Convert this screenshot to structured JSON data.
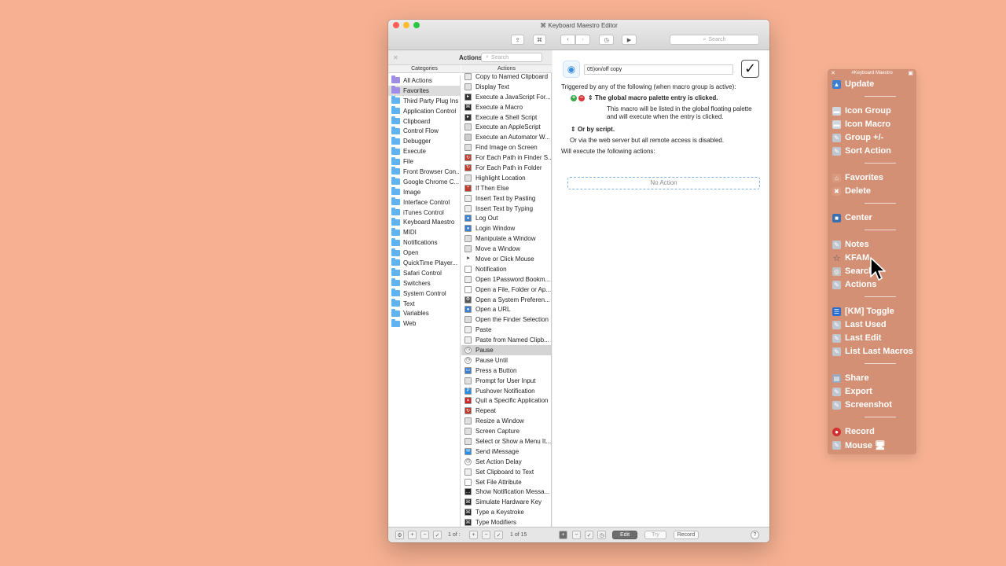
{
  "window": {
    "title": "Keyboard Maestro Editor",
    "search_placeholder": "Search"
  },
  "actions_panel": {
    "title": "Actions",
    "search_placeholder": "Search",
    "categories_header": "Categories",
    "actions_header": "Actions",
    "categories": [
      {
        "label": "All Actions",
        "icon": "purple-folder",
        "selected": false
      },
      {
        "label": "Favorites",
        "icon": "purple-folder",
        "selected": true
      },
      {
        "label": "Third Party Plug Ins",
        "icon": "blue-folder"
      },
      {
        "label": "Application Control",
        "icon": "blue-folder"
      },
      {
        "label": "Clipboard",
        "icon": "blue-folder"
      },
      {
        "label": "Control Flow",
        "icon": "blue-folder"
      },
      {
        "label": "Debugger",
        "icon": "blue-folder"
      },
      {
        "label": "Execute",
        "icon": "blue-folder"
      },
      {
        "label": "File",
        "icon": "blue-folder"
      },
      {
        "label": "Front Browser Con...",
        "icon": "blue-folder"
      },
      {
        "label": "Google Chrome C...",
        "icon": "blue-folder"
      },
      {
        "label": "Image",
        "icon": "blue-folder"
      },
      {
        "label": "Interface Control",
        "icon": "blue-folder"
      },
      {
        "label": "iTunes Control",
        "icon": "blue-folder"
      },
      {
        "label": "Keyboard Maestro",
        "icon": "blue-folder"
      },
      {
        "label": "MIDI",
        "icon": "blue-folder"
      },
      {
        "label": "Notifications",
        "icon": "blue-folder"
      },
      {
        "label": "Open",
        "icon": "blue-folder"
      },
      {
        "label": "QuickTime Player...",
        "icon": "blue-folder"
      },
      {
        "label": "Safari Control",
        "icon": "blue-folder"
      },
      {
        "label": "Switchers",
        "icon": "blue-folder"
      },
      {
        "label": "System Control",
        "icon": "blue-folder"
      },
      {
        "label": "Text",
        "icon": "blue-folder"
      },
      {
        "label": "Variables",
        "icon": "blue-folder"
      },
      {
        "label": "Web",
        "icon": "blue-folder"
      }
    ],
    "actions": [
      {
        "label": "Copy to Named Clipboard",
        "icon": "clipboard-icon",
        "color": "#e8e8e8"
      },
      {
        "label": "Display Text",
        "icon": "window-icon",
        "color": "#e0e0e0"
      },
      {
        "label": "Execute a JavaScript For...",
        "icon": "terminal-icon",
        "color": "#333333"
      },
      {
        "label": "Execute a Macro",
        "icon": "macro-icon",
        "color": "#222222"
      },
      {
        "label": "Execute a Shell Script",
        "icon": "terminal-icon",
        "color": "#333333"
      },
      {
        "label": "Execute an AppleScript",
        "icon": "script-icon",
        "color": "#dddddd"
      },
      {
        "label": "Execute an Automator W...",
        "icon": "automator-icon",
        "color": "#cccccc"
      },
      {
        "label": "Find Image on Screen",
        "icon": "window-icon",
        "color": "#e0e0e0"
      },
      {
        "label": "For Each Path in Finder S...",
        "icon": "loop-icon",
        "color": "#c0392b"
      },
      {
        "label": "For Each Path in Folder",
        "icon": "loop-icon",
        "color": "#c0392b"
      },
      {
        "label": "Highlight Location",
        "icon": "window-icon",
        "color": "#e0e0e0"
      },
      {
        "label": "If Then Else",
        "icon": "branch-icon",
        "color": "#c0392b"
      },
      {
        "label": "Insert Text by Pasting",
        "icon": "document-icon",
        "color": "#eeeeee"
      },
      {
        "label": "Insert Text by Typing",
        "icon": "document-icon",
        "color": "#eeeeee"
      },
      {
        "label": "Log Out",
        "icon": "person-icon",
        "color": "#3a7fd0"
      },
      {
        "label": "Login Window",
        "icon": "person-icon",
        "color": "#3a7fd0"
      },
      {
        "label": "Manipulate a Window",
        "icon": "window-icon",
        "color": "#e0e0e0"
      },
      {
        "label": "Move a Window",
        "icon": "window-icon",
        "color": "#e0e0e0"
      },
      {
        "label": "Move or Click Mouse",
        "icon": "pointer-icon",
        "color": "#ffffff"
      },
      {
        "label": "Notification",
        "icon": "notification-icon",
        "color": "#ffffff"
      },
      {
        "label": "Open 1Password Bookm...",
        "icon": "document-icon",
        "color": "#eeeeee"
      },
      {
        "label": "Open a File, Folder or Ap...",
        "icon": "document-icon",
        "color": "#ffffff"
      },
      {
        "label": "Open a System Preferen...",
        "icon": "preferences-icon",
        "color": "#555555"
      },
      {
        "label": "Open a URL",
        "icon": "person-icon",
        "color": "#3a7fd0"
      },
      {
        "label": "Open the Finder Selection",
        "icon": "finder-icon",
        "color": "#dddddd"
      },
      {
        "label": "Paste",
        "icon": "clipboard-icon",
        "color": "#eeeeee"
      },
      {
        "label": "Paste from Named Clipb...",
        "icon": "clipboard-icon",
        "color": "#eeeeee"
      },
      {
        "label": "Pause",
        "icon": "clock-icon",
        "color": "#ffffff"
      },
      {
        "label": "Pause Until",
        "icon": "clock-icon",
        "color": "#ffffff"
      },
      {
        "label": "Press a Button",
        "icon": "button-icon",
        "color": "#3a7fd0"
      },
      {
        "label": "Prompt for User Input",
        "icon": "window-icon",
        "color": "#e0e0e0"
      },
      {
        "label": "Pushover Notification",
        "icon": "pushover-icon",
        "color": "#2a8ee6"
      },
      {
        "label": "Quit a Specific Application",
        "icon": "quit-icon",
        "color": "#cc2222"
      },
      {
        "label": "Repeat",
        "icon": "loop-icon",
        "color": "#c0392b"
      },
      {
        "label": "Resize a Window",
        "icon": "window-icon",
        "color": "#e0e0e0"
      },
      {
        "label": "Screen Capture",
        "icon": "window-icon",
        "color": "#e0e0e0"
      },
      {
        "label": "Select or Show a Menu It...",
        "icon": "menu-icon",
        "color": "#e0e0e0"
      },
      {
        "label": "Send iMessage",
        "icon": "message-icon",
        "color": "#2a8ee6"
      },
      {
        "label": "Set Action Delay",
        "icon": "clock-icon",
        "color": "#ffffff"
      },
      {
        "label": "Set Clipboard to Text",
        "icon": "clipboard-icon",
        "color": "#eeeeee"
      },
      {
        "label": "Set File Attribute",
        "icon": "document-icon",
        "color": "#ffffff"
      },
      {
        "label": "Show Notification Messa...",
        "icon": "speech-icon",
        "color": "#222222"
      },
      {
        "label": "Simulate Hardware Key",
        "icon": "macro-icon",
        "color": "#222222"
      },
      {
        "label": "Type a Keystroke",
        "icon": "macro-icon",
        "color": "#222222"
      },
      {
        "label": "Type Modifiers",
        "icon": "macro-icon",
        "color": "#222222"
      }
    ],
    "selected_action": "Pause"
  },
  "editor": {
    "macro_name": "05)on/off copy",
    "enabled": true,
    "triggered_by": "Triggered by any of the following (when macro group is active):",
    "trigger_title": "The global macro palette entry is clicked.",
    "trigger_desc_1": "This macro will be listed in the global floating palette",
    "trigger_desc_2": "and will execute when the entry is clicked.",
    "or_by_script": "Or by script.",
    "web_server": "Or via the web server but all remote access is disabled.",
    "will_execute": "Will execute the following actions:",
    "no_action": "No Action"
  },
  "bottom_bar": {
    "cat_count": "1 of :",
    "action_count": "1 of 15",
    "edit_label": "Edit",
    "try_label": "Try",
    "record_label": "Record",
    "help_label": "?"
  },
  "palette": {
    "title": "#Keyboard Maestro",
    "items": [
      {
        "label": "Update",
        "icon": "update-icon",
        "color": "#3a7fd0",
        "glyph": "▲"
      },
      {
        "sep": true
      },
      {
        "label": "Icon Group",
        "icon": "window-icon",
        "color": "#cfd6e0",
        "glyph": "▬"
      },
      {
        "label": "Icon Macro",
        "icon": "window-icon",
        "color": "#cfd6e0",
        "glyph": "▬"
      },
      {
        "label": "Group +/-",
        "icon": "macro-doc-icon",
        "color": "#bfc6d0",
        "glyph": "✎"
      },
      {
        "label": "Sort Action",
        "icon": "macro-doc-icon",
        "color": "#bfc6d0",
        "glyph": "✎"
      },
      {
        "sep": true
      },
      {
        "label": "Favorites",
        "icon": "house-icon",
        "color": "#d99a7d",
        "glyph": "⌂"
      },
      {
        "label": "Delete",
        "icon": "trash-icon",
        "color": "#d99a7d",
        "glyph": "✖"
      },
      {
        "sep": true
      },
      {
        "label": "Center",
        "icon": "monitor-icon",
        "color": "#3a6fb0",
        "glyph": "■"
      },
      {
        "sep": true
      },
      {
        "label": "Notes",
        "icon": "macro-doc-icon",
        "color": "#bfc6d0",
        "glyph": "✎"
      },
      {
        "label": "KFAM",
        "icon": "star-icon",
        "color": "transparent",
        "glyph": "☆"
      },
      {
        "label": "Search",
        "icon": "magnifier-icon",
        "color": "#c0c0c0",
        "glyph": "◎"
      },
      {
        "label": "Actions",
        "icon": "macro-doc-icon",
        "color": "#bfc6d0",
        "glyph": "✎"
      },
      {
        "sep": true
      },
      {
        "label": "[KM] Toggle",
        "icon": "toggle-icon",
        "color": "#2a6fd0",
        "glyph": "☰"
      },
      {
        "label": "Last Used",
        "icon": "macro-doc-icon",
        "color": "#bfc6d0",
        "glyph": "✎"
      },
      {
        "label": "Last Edit",
        "icon": "macro-doc-icon",
        "color": "#bfc6d0",
        "glyph": "✎"
      },
      {
        "label": "List Last Macros",
        "icon": "macro-doc-icon",
        "color": "#bfc6d0",
        "glyph": "✎"
      },
      {
        "sep": true
      },
      {
        "label": "Share",
        "icon": "clipboard-icon",
        "color": "#9aa9bd",
        "glyph": "▤"
      },
      {
        "label": "Export",
        "icon": "macro-doc-icon",
        "color": "#bfc6d0",
        "glyph": "✎"
      },
      {
        "label": "Screenshot",
        "icon": "macro-doc-icon",
        "color": "#bfc6d0",
        "glyph": "✎"
      },
      {
        "sep": true
      },
      {
        "label": "Record",
        "icon": "record-icon",
        "color": "#d03030",
        "glyph": "●"
      },
      {
        "label": "Mouse 🖥",
        "icon": "macro-doc-icon",
        "color": "#bfc6d0",
        "glyph": "✎"
      }
    ]
  }
}
